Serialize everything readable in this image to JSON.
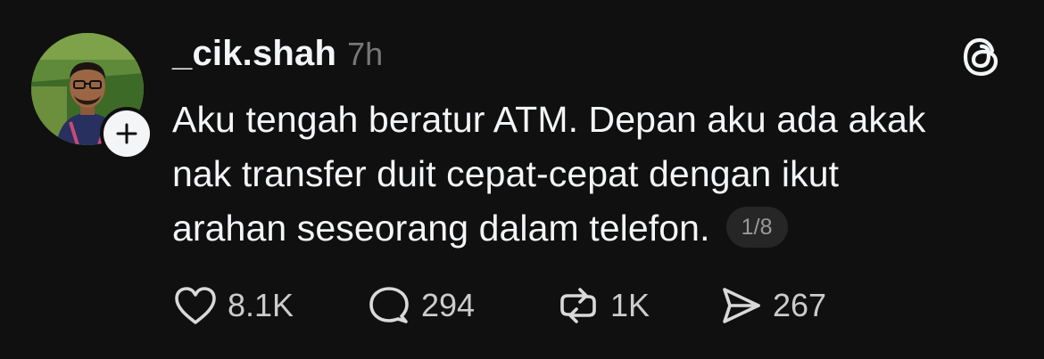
{
  "post": {
    "username": "_cik.shah",
    "timestamp": "7h",
    "text_lines": [
      "Aku tengah beratur ATM. Depan aku ada akak",
      "nak transfer duit cepat-cepat dengan ikut",
      "arahan seseorang dalam telefon."
    ],
    "page_counter": "1/8"
  },
  "actions": {
    "likes": "8.1K",
    "replies": "294",
    "reposts": "1K",
    "shares": "267"
  },
  "icons": {
    "follow": "plus-icon",
    "app_logo": "threads-logo-icon",
    "like": "heart-icon",
    "reply": "speech-bubble-icon",
    "repost": "repost-arrows-icon",
    "share": "send-icon"
  },
  "colors": {
    "background": "#101010",
    "primary_text": "#f3f5f7",
    "secondary_text": "#777777",
    "counter_bg": "#262626"
  }
}
